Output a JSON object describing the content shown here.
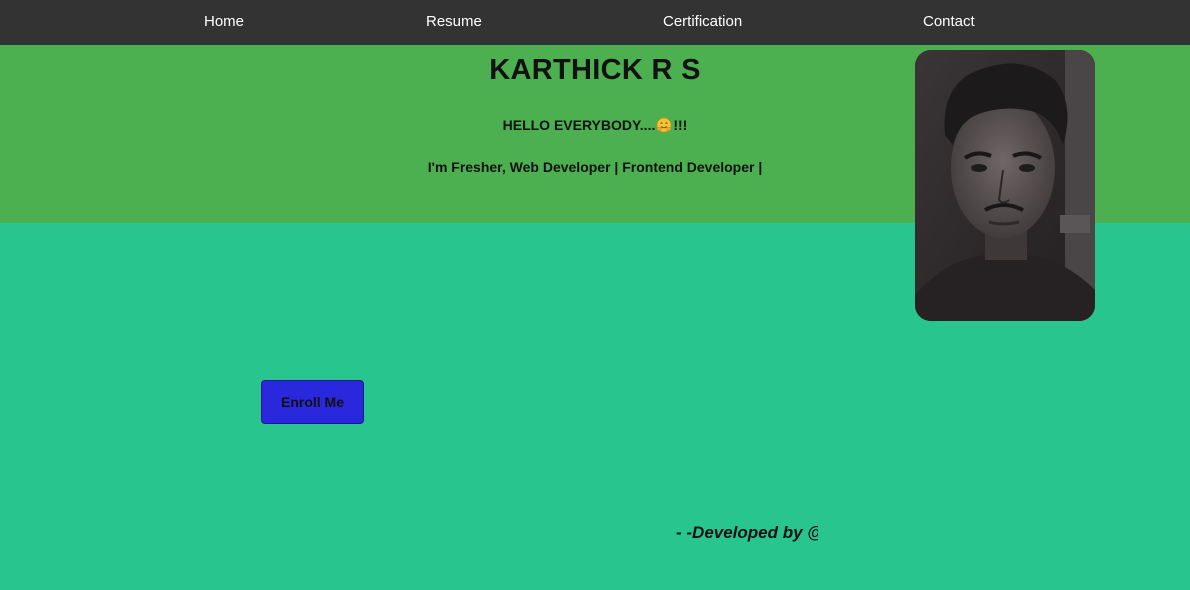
{
  "nav": {
    "items": [
      {
        "label": "Home"
      },
      {
        "label": "Resume"
      },
      {
        "label": "Certification"
      },
      {
        "label": "Contact"
      }
    ]
  },
  "hero": {
    "name": "KARTHICK R S",
    "greeting_prefix": "HELLO EVERYBODY....",
    "greeting_emoji": "hugging-face-icon",
    "greeting_suffix": "!!!",
    "tagline": "I'm Fresher, Web Developer | Frontend Developer |"
  },
  "profile_photo": {
    "icon": "profile-photo"
  },
  "cta": {
    "enroll_label": "Enroll Me"
  },
  "footer": {
    "credit": "- -Developed by @"
  },
  "colors": {
    "nav_bg": "#333333",
    "hero_bg": "#4caf50",
    "page_bg": "#29c58e",
    "button_bg": "#2a28dc"
  }
}
